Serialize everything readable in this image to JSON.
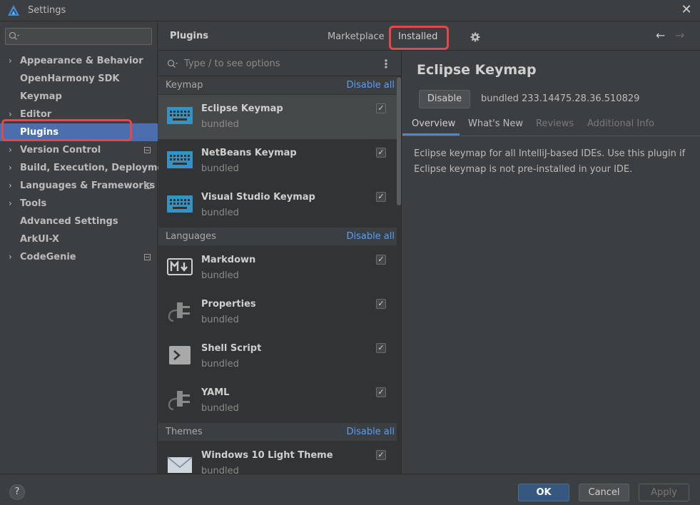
{
  "window": {
    "title": "Settings"
  },
  "sidebar": {
    "items": [
      {
        "label": "Appearance & Behavior",
        "arrow": true,
        "badge": false
      },
      {
        "label": "OpenHarmony SDK",
        "arrow": false,
        "badge": false
      },
      {
        "label": "Keymap",
        "arrow": false,
        "badge": false
      },
      {
        "label": "Editor",
        "arrow": true,
        "badge": false
      },
      {
        "label": "Plugins",
        "arrow": false,
        "badge": false,
        "selected": true
      },
      {
        "label": "Version Control",
        "arrow": true,
        "badge": true
      },
      {
        "label": "Build, Execution, Deployment",
        "arrow": true,
        "badge": false
      },
      {
        "label": "Languages & Frameworks",
        "arrow": true,
        "badge": true
      },
      {
        "label": "Tools",
        "arrow": true,
        "badge": false
      },
      {
        "label": "Advanced Settings",
        "arrow": false,
        "badge": false
      },
      {
        "label": "ArkUI-X",
        "arrow": false,
        "badge": false
      },
      {
        "label": "CodeGenie",
        "arrow": true,
        "badge": true
      }
    ]
  },
  "header": {
    "title": "Plugins",
    "tabs": [
      "Marketplace",
      "Installed"
    ],
    "active_tab": "Installed"
  },
  "list": {
    "search_placeholder": "Type / to see options",
    "groups": [
      {
        "name": "Keymap",
        "action": "Disable all",
        "items": [
          {
            "name": "Eclipse Keymap",
            "sub": "bundled",
            "icon": "keyboard-icon",
            "checked": true,
            "selected": true
          },
          {
            "name": "NetBeans Keymap",
            "sub": "bundled",
            "icon": "keyboard-icon",
            "checked": true
          },
          {
            "name": "Visual Studio Keymap",
            "sub": "bundled",
            "icon": "keyboard-icon",
            "checked": true
          }
        ]
      },
      {
        "name": "Languages",
        "action": "Disable all",
        "items": [
          {
            "name": "Markdown",
            "sub": "bundled",
            "icon": "markdown-icon",
            "checked": true
          },
          {
            "name": "Properties",
            "sub": "bundled",
            "icon": "plug-icon",
            "checked": true
          },
          {
            "name": "Shell Script",
            "sub": "bundled",
            "icon": "terminal-icon",
            "checked": true
          },
          {
            "name": "YAML",
            "sub": "bundled",
            "icon": "plug-icon",
            "checked": true
          }
        ]
      },
      {
        "name": "Themes",
        "action": "Disable all",
        "items": [
          {
            "name": "Windows 10 Light Theme",
            "sub": "bundled",
            "icon": "envelope-icon",
            "checked": true
          }
        ]
      }
    ]
  },
  "detail": {
    "title": "Eclipse Keymap",
    "disable_label": "Disable",
    "version": "bundled 233.14475.28.36.510829",
    "tabs": [
      "Overview",
      "What's New",
      "Reviews",
      "Additional Info"
    ],
    "description": "Eclipse keymap for all IntelliJ-based IDEs. Use this plugin if Eclipse keymap is not pre-installed in your IDE."
  },
  "footer": {
    "help": "?",
    "ok": "OK",
    "cancel": "Cancel",
    "apply": "Apply"
  },
  "colors": {
    "accent": "#4b6eaf",
    "link": "#589df6",
    "highlight": "#e8474a",
    "primary_button": "#365880"
  }
}
